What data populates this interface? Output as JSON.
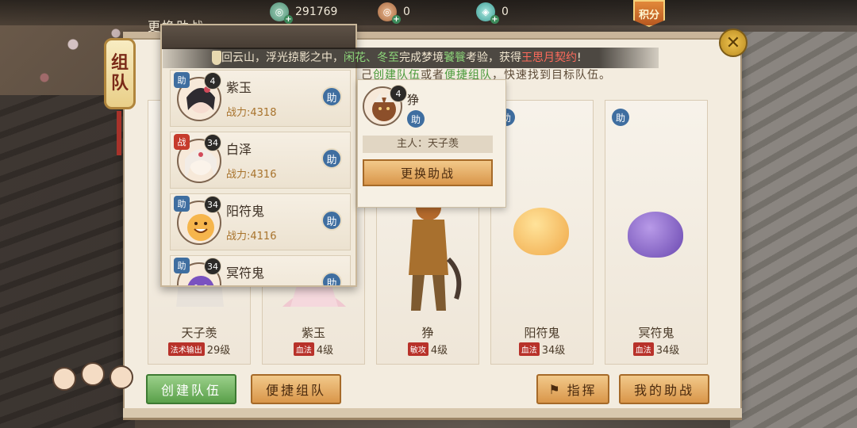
{
  "resources": {
    "jade": {
      "value": "291769",
      "icon": "jade-coin-icon"
    },
    "copper": {
      "value": "0",
      "icon": "copper-coin-icon"
    },
    "spirit": {
      "value": "0",
      "icon": "spirit-coin-icon"
    },
    "score_badge": "积分"
  },
  "header": {
    "tab_title": "更换助战",
    "lantern_label_1": "组",
    "lantern_label_2": "队"
  },
  "marquee": {
    "pre": "回云山，浮光掠影之中，",
    "green1": "闲花、冬至",
    "mid": "完成梦境",
    "green2": "饕餮",
    "mid2": "考验，获得",
    "red": "王思月契约",
    "end": "!"
  },
  "hint": {
    "pre": "己",
    "hl1": "创建队伍",
    "mid": "或者",
    "hl2": "便捷组队",
    "end": "，快速找到目标队伍。"
  },
  "picker": {
    "rows": [
      {
        "tag": "助",
        "tag_type": "assist",
        "level": "4",
        "name": "紫玉",
        "power": "战力:4318",
        "button": "助"
      },
      {
        "tag": "战",
        "tag_type": "battle",
        "level": "34",
        "name": "白泽",
        "power": "战力:4316",
        "button": "助"
      },
      {
        "tag": "助",
        "tag_type": "assist",
        "level": "34",
        "name": "阳符鬼",
        "power": "战力:4116",
        "button": "助"
      },
      {
        "tag": "助",
        "tag_type": "assist",
        "level": "34",
        "name": "冥符鬼",
        "power": "",
        "button": "助"
      }
    ]
  },
  "detail": {
    "level": "4",
    "name": "狰",
    "assist": "助",
    "owner": "主人：天子羡",
    "button": "更换助战"
  },
  "slots": [
    {
      "name": "天子羡",
      "school": "法术输出",
      "level": "29级",
      "assist": ""
    },
    {
      "name": "紫玉",
      "school": "血法",
      "level": "4级",
      "assist": ""
    },
    {
      "name": "狰",
      "school": "敏攻",
      "level": "4级",
      "assist": ""
    },
    {
      "name": "阳符鬼",
      "school": "血法",
      "level": "34级",
      "assist": "助"
    },
    {
      "name": "冥符鬼",
      "school": "血法",
      "level": "34级",
      "assist": "助"
    }
  ],
  "buttons": {
    "create_team": "创建队伍",
    "quick_team": "便捷组队",
    "command": "指挥",
    "my_assist": "我的助战"
  },
  "colors": {
    "accent_gold": "#d9964a",
    "accent_green": "#5aa04a",
    "assist_blue": "#3f6ea0",
    "school_red": "#b8322a"
  }
}
